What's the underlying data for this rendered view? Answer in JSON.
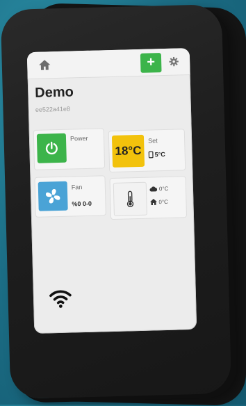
{
  "header": {
    "add_label": "+"
  },
  "device": {
    "name": "Demo",
    "id": "ee522a41e8"
  },
  "cards": {
    "power": {
      "label": "Power"
    },
    "setpoint": {
      "temp": "18°C",
      "label": "Set",
      "value": "5°C"
    },
    "fan": {
      "label": "Fan",
      "value": "%0 0-0"
    },
    "readings": {
      "outdoor": "0°C",
      "indoor": "0°C"
    }
  },
  "colors": {
    "power_tile": "#3cb44a",
    "setpoint_tile": "#f2c20c",
    "fan_tile": "#4aa3d6",
    "add_button": "#3cb44a"
  },
  "icons": [
    "home-icon",
    "gear-icon",
    "power-icon",
    "fan-icon",
    "thermometer-icon",
    "cloud-icon",
    "house-icon",
    "phone-icon",
    "wifi-icon"
  ]
}
